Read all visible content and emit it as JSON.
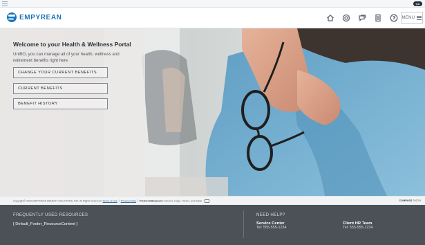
{
  "topbar": {
    "badge": "QA"
  },
  "header": {
    "logo_text": "EMPYREAN",
    "icons": [
      "home-icon",
      "help-circle-icon",
      "chat-icon",
      "document-icon",
      "question-icon"
    ],
    "menu_label": "MENU"
  },
  "hero": {
    "title": "Welcome to your Health & Wellness Portal",
    "intro": "UniBO, you can manage all of your health, wellness and retirement benefits right here",
    "buttons": [
      {
        "label": "CHANGE YOUR CURRENT BENEFITS"
      },
      {
        "label": "CURRENT BENEFITS"
      },
      {
        "label": "BENEFIT HISTORY"
      }
    ]
  },
  "copyright": {
    "text": "Copyright© 2022 EMPYREAN BENEFIT SOLUTIONS, INC. All Rights Reserved.",
    "terms": "Terms of Use",
    "privacy": "Privacy Policy",
    "preferred_label": "Preferred Browsers:",
    "browsers": "Chrome, Edge, Firefox, and Safari",
    "compass": "COMPASS",
    "version": "2022.8"
  },
  "footer": {
    "resources_title": "FREQUENTLY USED RESOURCES",
    "resources_content": "[ Default_Footer_ResourceContent ]",
    "help_title": "NEED HELP?",
    "service_center_title": "Service Center",
    "service_center_phone": "Tel: 555-555-1234",
    "client_hr_title": "Client HR Team",
    "client_hr_phone": "Tel: 555-555-1234"
  }
}
